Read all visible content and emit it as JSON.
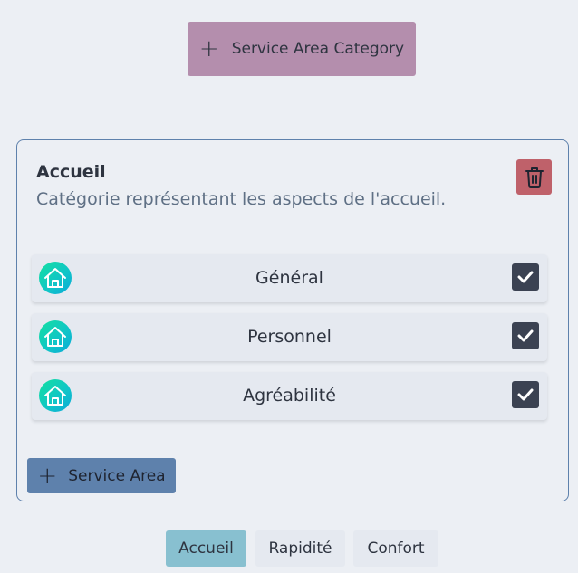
{
  "toolbar": {
    "add_category_label": "Service Area Category"
  },
  "category": {
    "title": "Accueil",
    "description": "Catégorie représentant les aspects de l'accueil.",
    "areas": [
      {
        "label": "Général",
        "checked": true,
        "icon": "home-icon"
      },
      {
        "label": "Personnel",
        "checked": true,
        "icon": "home-icon"
      },
      {
        "label": "Agréabilité",
        "checked": true,
        "icon": "home-icon"
      }
    ],
    "add_area_label": "Service Area"
  },
  "tabs": [
    {
      "label": "Accueil",
      "active": true
    },
    {
      "label": "Rapidité",
      "active": false
    },
    {
      "label": "Confort",
      "active": false
    }
  ],
  "colors": {
    "background": "#eceff4",
    "category_button": "#b48ead",
    "delete_button": "#bf616a",
    "add_area_button": "#5e81ac",
    "active_tab": "#88c0d0",
    "checkbox": "#3b4252"
  }
}
